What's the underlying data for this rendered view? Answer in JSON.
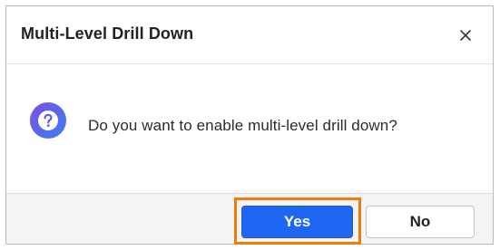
{
  "dialog": {
    "title": "Multi-Level Drill Down",
    "message": "Do you want to enable multi-level drill down?",
    "icon": "question-icon",
    "close_icon": "close-icon"
  },
  "buttons": {
    "yes_label": "Yes",
    "no_label": "No"
  },
  "colors": {
    "primary": "#1f66f2",
    "highlight": "#f07d0a",
    "icon_gradient_start": "#6c5ce7",
    "icon_gradient_end": "#3b82f6"
  }
}
